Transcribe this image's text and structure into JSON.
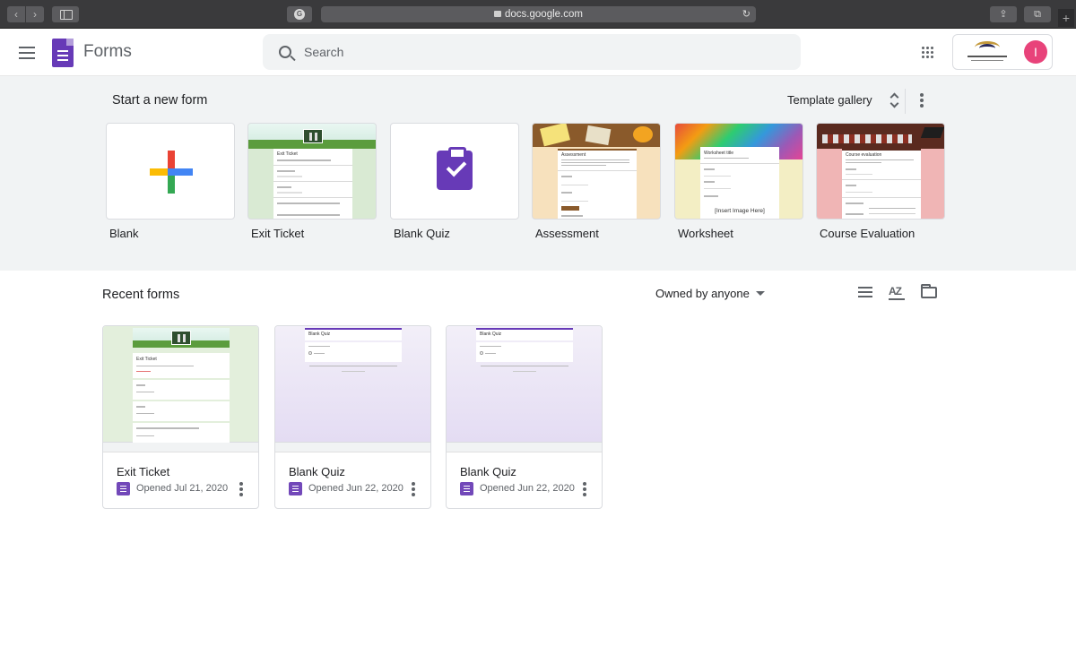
{
  "browser": {
    "url": "docs.google.com",
    "ext_glyph": "G"
  },
  "header": {
    "app_name": "Forms",
    "search_placeholder": "Search",
    "avatar_initial": "I"
  },
  "templates": {
    "title": "Start a new form",
    "gallery_label": "Template gallery",
    "items": [
      {
        "label": "Blank"
      },
      {
        "label": "Exit Ticket",
        "preview_title": "Exit Ticket"
      },
      {
        "label": "Blank Quiz"
      },
      {
        "label": "Assessment",
        "preview_title": "Assessment"
      },
      {
        "label": "Worksheet",
        "preview_title": "Worksheet title",
        "preview_image_text": "[Insert Image Here]"
      },
      {
        "label": "Course Evaluation",
        "preview_title": "Course evaluation"
      }
    ]
  },
  "recent": {
    "title": "Recent forms",
    "owner_filter": "Owned by anyone",
    "items": [
      {
        "name": "Exit Ticket",
        "opened": "Opened Jul 21, 2020",
        "preview_title": "Exit Ticket"
      },
      {
        "name": "Blank Quiz",
        "opened": "Opened Jun 22, 2020",
        "preview_title": "Blank Quiz"
      },
      {
        "name": "Blank Quiz",
        "opened": "Opened Jun 22, 2020",
        "preview_title": "Blank Quiz"
      }
    ]
  },
  "colors": {
    "forms_purple": "#673ab7",
    "avatar_pink": "#e8437a",
    "template_bg": "#f1f3f4"
  }
}
